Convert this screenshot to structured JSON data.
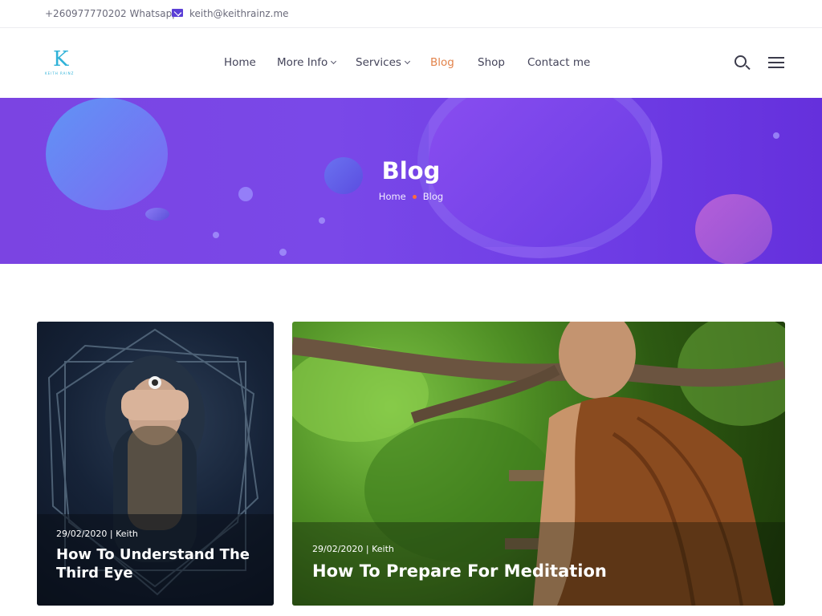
{
  "topbar": {
    "phone": "+260977770202 Whatsapp",
    "email": "keith@keithrainz.me"
  },
  "logo": {
    "mark": "K",
    "tagline": "KEITH RAINZ"
  },
  "nav": {
    "home": "Home",
    "more_info": "More Info",
    "services": "Services",
    "blog": "Blog",
    "shop": "Shop",
    "contact": "Contact me"
  },
  "hero": {
    "title": "Blog",
    "breadcrumb_home": "Home",
    "breadcrumb_current": "Blog"
  },
  "posts": [
    {
      "meta": "29/02/2020 | Keith",
      "title": "How To Understand The Third Eye"
    },
    {
      "meta": "29/02/2020 | Keith",
      "title": "How To Prepare For Meditation"
    }
  ],
  "colors": {
    "accent": "#5b3fd6",
    "active_nav": "#e2834b",
    "hero_purple": "#7a48e8",
    "crumb_dot": "#ff6b3d"
  },
  "icons": [
    "mail-icon",
    "search-icon",
    "menu-icon",
    "chevron-down-icon"
  ]
}
